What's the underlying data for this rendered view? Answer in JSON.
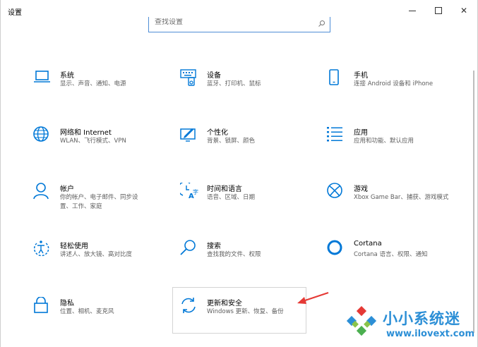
{
  "window": {
    "title": "设置",
    "controls": {
      "minimize": "minimize",
      "maximize": "maximize",
      "close": "✕"
    }
  },
  "search": {
    "placeholder": "查找设置"
  },
  "tiles": [
    {
      "title": "系统",
      "desc": "显示、声音、通知、电源",
      "icon": "laptop-icon"
    },
    {
      "title": "设备",
      "desc": "蓝牙、打印机、鼠标",
      "icon": "keyboard-icon"
    },
    {
      "title": "手机",
      "desc": "连接 Android 设备和 iPhone",
      "icon": "phone-icon"
    },
    {
      "title": "网络和 Internet",
      "desc": "WLAN、飞行模式、VPN",
      "icon": "globe-icon"
    },
    {
      "title": "个性化",
      "desc": "背景、锁屏、颜色",
      "icon": "personalize-icon"
    },
    {
      "title": "应用",
      "desc": "应用和功能、默认应用",
      "icon": "apps-list-icon"
    },
    {
      "title": "帐户",
      "desc": "你的帐户、电子邮件、同步设\n置、工作、家庭",
      "icon": "person-icon"
    },
    {
      "title": "时间和语言",
      "desc": "语音、区域、日期",
      "icon": "time-language-icon"
    },
    {
      "title": "游戏",
      "desc": "Xbox Game Bar、捕获、游戏模式",
      "icon": "xbox-icon"
    },
    {
      "title": "轻松使用",
      "desc": "讲述人、放大镜、高对比度",
      "icon": "ease-of-access-icon"
    },
    {
      "title": "搜索",
      "desc": "查找我的文件、权限",
      "icon": "search-magnifier-icon"
    },
    {
      "title": "Cortana",
      "desc": "Cortana 语言、权限、通知",
      "icon": "cortana-icon"
    },
    {
      "title": "隐私",
      "desc": "位置、相机、麦克风",
      "icon": "lock-icon"
    },
    {
      "title": "更新和安全",
      "desc": "Windows 更新、恢复、备份",
      "icon": "update-icon"
    }
  ],
  "watermark": {
    "name": "小小系统迷",
    "url": "www.ilovext.com"
  },
  "colors": {
    "accent": "#0078d7",
    "arrow": "#e53935",
    "watermark": "#2c8fd6"
  }
}
